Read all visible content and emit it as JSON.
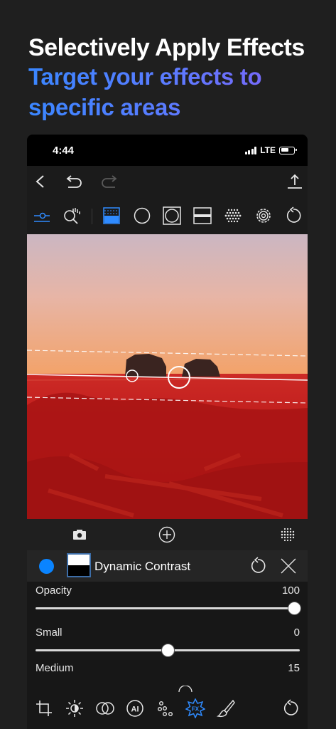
{
  "headline": {
    "title": "Selectively Apply Effects",
    "subtitle_line1": "Target your effects to",
    "subtitle_line2": "specific areas"
  },
  "status_bar": {
    "time": "4:44",
    "network": "LTE"
  },
  "navbar": {
    "icons": [
      "back-icon",
      "undo-icon",
      "redo-icon",
      "share-icon"
    ]
  },
  "toolbar": {
    "icons": [
      "mask-toggle-icon",
      "search-hand-icon",
      "gradient-mask-icon",
      "radial-mask-icon",
      "vignette-mask-icon",
      "linear-mask-icon",
      "dots-mask-icon",
      "gear-icon",
      "reset-icon"
    ],
    "selected": "gradient-mask-icon"
  },
  "photo_overlay": {
    "mask_color": "#c81e1e"
  },
  "photobar": {
    "icons": [
      "camera-icon",
      "add-icon",
      "mask-dots-icon"
    ]
  },
  "layer": {
    "name": "Dynamic Contrast",
    "color": "#0a84ff"
  },
  "sliders": [
    {
      "label": "Opacity",
      "value": "100",
      "fraction": 1.0
    },
    {
      "label": "Small",
      "value": "0",
      "fraction": 0.5
    },
    {
      "label": "Medium",
      "value": "15"
    }
  ],
  "bottom_tools": {
    "icons": [
      "crop-icon",
      "light-icon",
      "color-blend-icon",
      "ai-icon",
      "presets-icon",
      "fx-icon",
      "brush-icon",
      "revert-icon"
    ],
    "selected": "fx-icon"
  }
}
